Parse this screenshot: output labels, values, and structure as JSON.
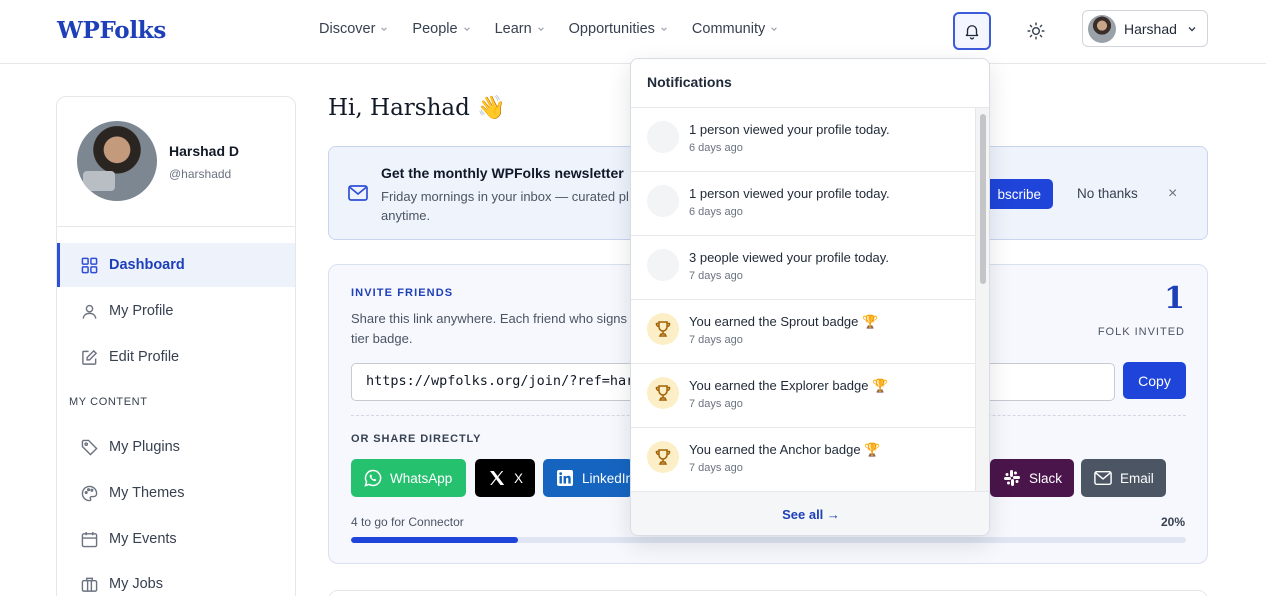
{
  "header": {
    "logo": "WPFolks",
    "nav": [
      "Discover",
      "People",
      "Learn",
      "Opportunities",
      "Community"
    ],
    "user_name": "Harshad"
  },
  "sidebar": {
    "name": "Harshad D",
    "handle": "@harshadd",
    "items": [
      {
        "label": "Dashboard",
        "icon": "grid-icon",
        "active": true
      },
      {
        "label": "My Profile",
        "icon": "user-icon"
      },
      {
        "label": "Edit Profile",
        "icon": "edit-icon"
      }
    ],
    "section_label": "MY CONTENT",
    "content_items": [
      {
        "label": "My Plugins",
        "icon": "tag-icon"
      },
      {
        "label": "My Themes",
        "icon": "palette-icon"
      },
      {
        "label": "My Events",
        "icon": "calendar-icon"
      },
      {
        "label": "My Jobs",
        "icon": "briefcase-icon"
      }
    ]
  },
  "main": {
    "greeting": "Hi, Harshad 👋",
    "newsletter": {
      "title": "Get the monthly WPFolks newsletter",
      "text": "Friday mornings in your inbox — curated pl anytime.",
      "subscribe_label": "bscribe",
      "no_thanks_label": "No thanks",
      "close_label": "×"
    },
    "invite": {
      "label": "INVITE FRIENDS",
      "text": "Share this link anywhere. Each friend who signs u tier badge.",
      "count": "1",
      "count_label": "FOLK INVITED",
      "link": "https://wpfolks.org/join/?ref=hars",
      "copy_label": "Copy",
      "share_label": "OR SHARE DIRECTLY",
      "share_buttons": [
        {
          "label": "WhatsApp",
          "color": "#25c16f"
        },
        {
          "label": "X",
          "color": "#000000"
        },
        {
          "label": "LinkedIn",
          "color": "#1565c0"
        },
        {
          "label": "Slack",
          "color": "#4a154b"
        },
        {
          "label": "Email",
          "color": "#4b5563"
        }
      ],
      "progress_text": "4 to go for Connector",
      "progress_pct_label": "20%",
      "progress_fraction": 0.2
    }
  },
  "notifications": {
    "title": "Notifications",
    "items": [
      {
        "message": "1 person viewed your profile today.",
        "time": "6 days ago",
        "type": "view"
      },
      {
        "message": "1 person viewed your profile today.",
        "time": "6 days ago",
        "type": "view"
      },
      {
        "message": "3 people viewed your profile today.",
        "time": "7 days ago",
        "type": "view"
      },
      {
        "message": "You earned the Sprout badge 🏆",
        "time": "7 days ago",
        "type": "badge"
      },
      {
        "message": "You earned the Explorer badge 🏆",
        "time": "7 days ago",
        "type": "badge"
      },
      {
        "message": "You earned the Anchor badge 🏆",
        "time": "7 days ago",
        "type": "badge"
      }
    ],
    "see_all_label": "See all →"
  }
}
